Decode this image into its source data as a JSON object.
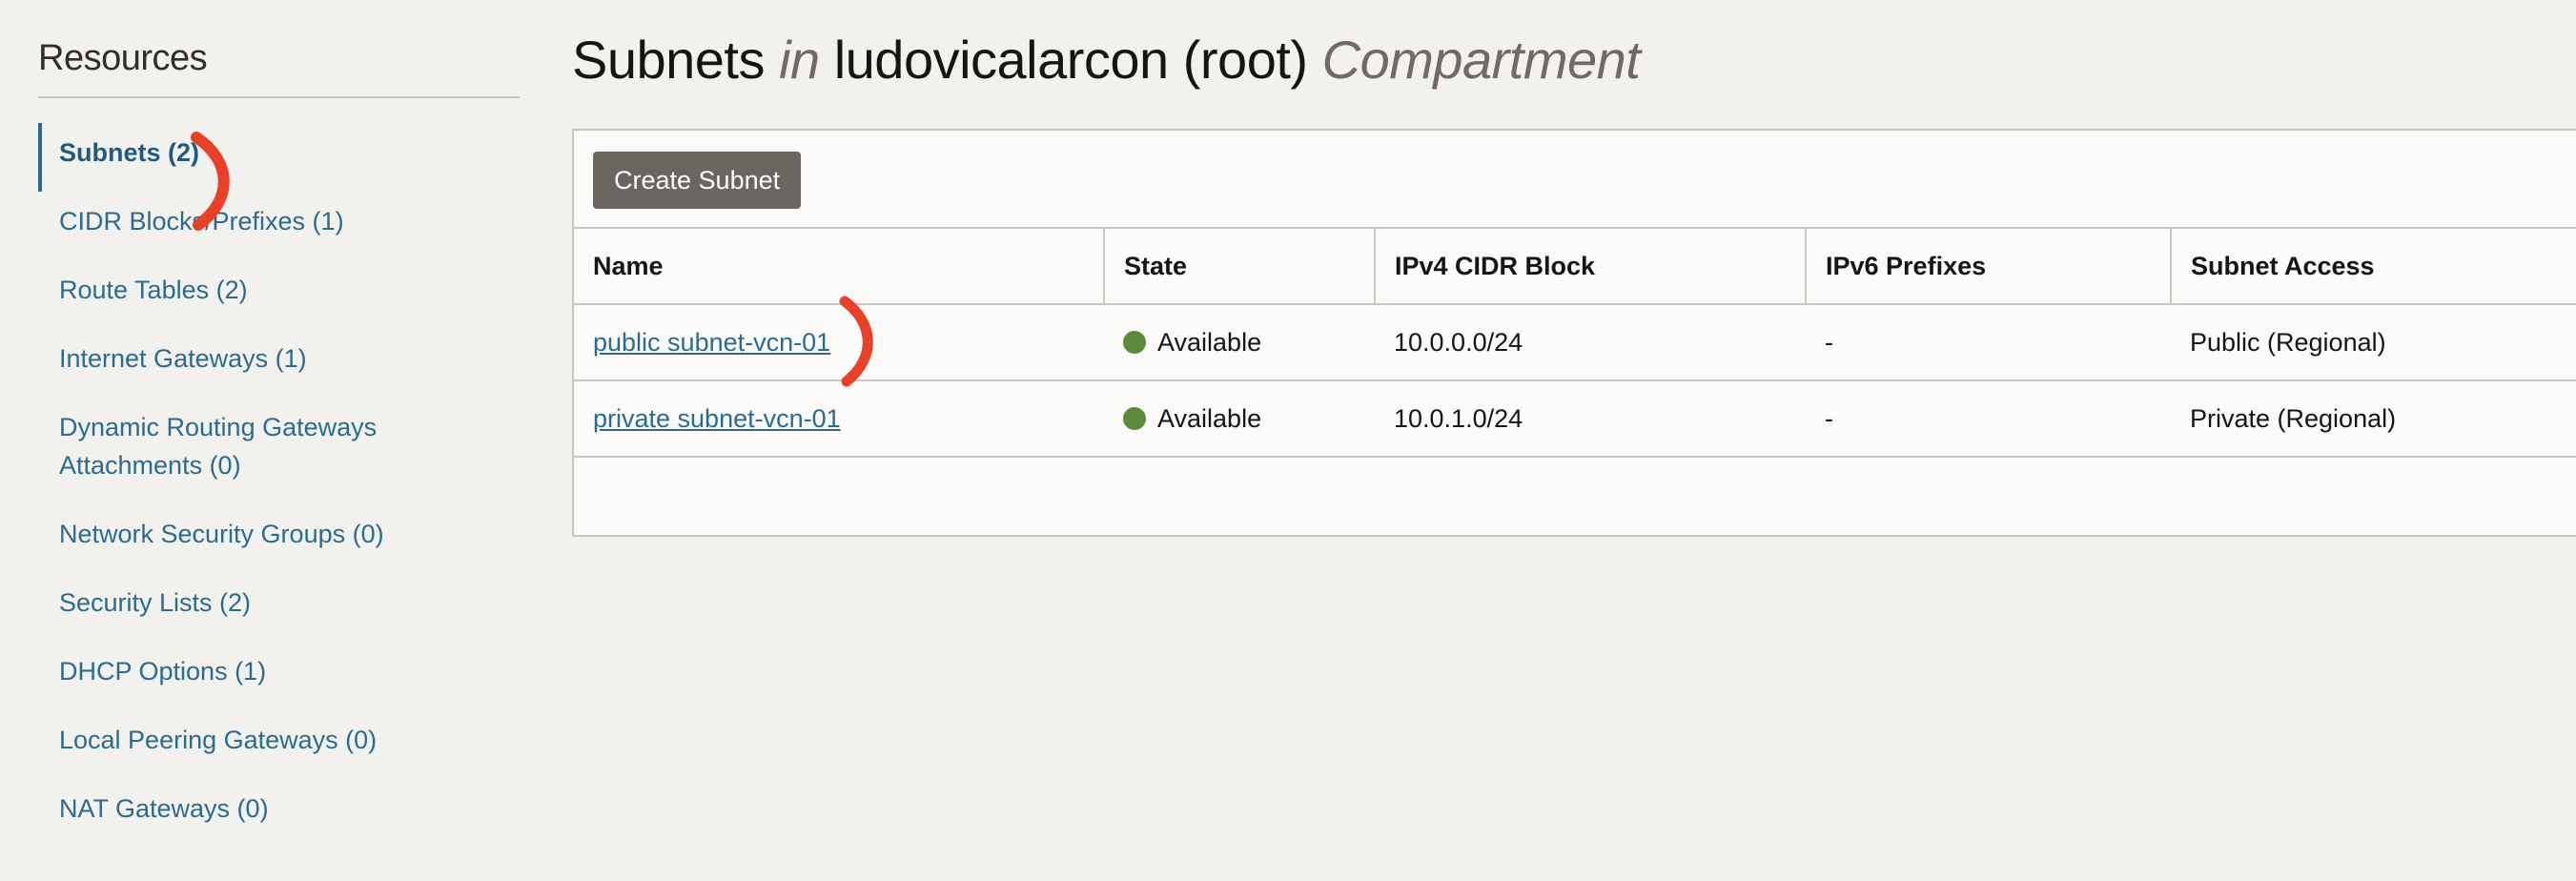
{
  "sidebar": {
    "title": "Resources",
    "items": [
      {
        "label": "Subnets (2)",
        "active": true
      },
      {
        "label": "CIDR Blocks/Prefixes (1)"
      },
      {
        "label": "Route Tables (2)"
      },
      {
        "label": "Internet Gateways (1)"
      },
      {
        "label_line1": "Dynamic Routing Gateways",
        "label_line2": "Attachments (0)"
      },
      {
        "label": "Network Security Groups (0)"
      },
      {
        "label": "Security Lists (2)"
      },
      {
        "label": "DHCP Options (1)"
      },
      {
        "label": "Local Peering Gateways (0)"
      },
      {
        "label": "NAT Gateways (0)"
      }
    ]
  },
  "header": {
    "title_part1": "Subnets",
    "title_in": "in",
    "title_compartment_name": "ludovicalarcon (root)",
    "title_compartment_word": "Compartment"
  },
  "toolbar": {
    "create_label": "Create Subnet"
  },
  "table": {
    "columns": [
      "Name",
      "State",
      "IPv4 CIDR Block",
      "IPv6 Prefixes",
      "Subnet Access"
    ],
    "rows": [
      {
        "name": "public subnet-vcn-01",
        "state": "Available",
        "ipv4": "10.0.0.0/24",
        "ipv6": "-",
        "access": "Public (Regional)"
      },
      {
        "name": "private subnet-vcn-01",
        "state": "Available",
        "ipv4": "10.0.1.0/24",
        "ipv6": "-",
        "access": "Private (Regional)"
      }
    ]
  },
  "colors": {
    "link": "#2b6b8f",
    "status_available": "#5a8a3a",
    "annotation": "#e8412a",
    "button_bg": "#6b6560"
  }
}
